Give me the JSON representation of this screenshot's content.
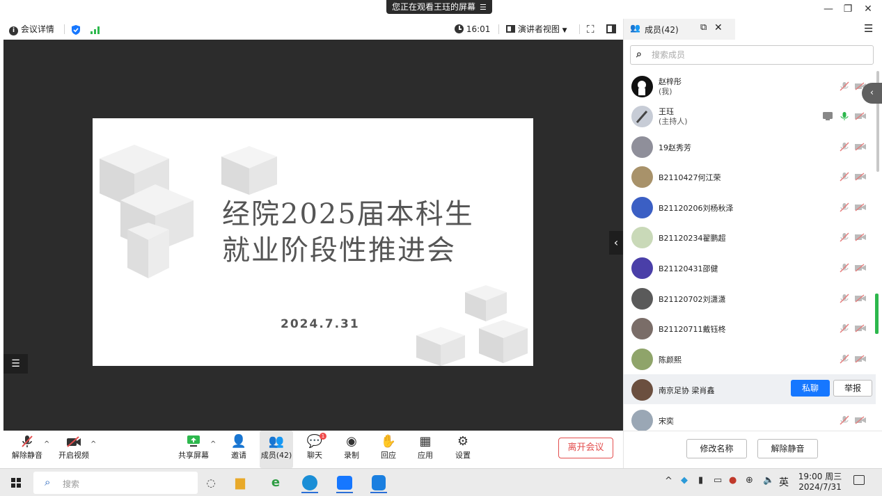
{
  "titlebar": {
    "share_notice": "您正在观看王珏的屏幕",
    "share_menu_glyph": "☰"
  },
  "meeting_bar": {
    "details_label": "会议详情",
    "time": "16:01",
    "view_mode": "演讲者视图"
  },
  "slide": {
    "title_line1": "经院2025届本科生",
    "title_line2": "就业阶段性推进会",
    "date": "2024.7.31"
  },
  "controls": {
    "unmute": "解除静音",
    "start_video": "开启视频",
    "share_screen": "共享屏幕",
    "invite": "邀请",
    "members": "成员(42)",
    "chat": "聊天",
    "chat_badge": "1",
    "record": "录制",
    "react": "回应",
    "apps": "应用",
    "settings": "设置",
    "leave": "离开会议"
  },
  "panel": {
    "tab_label": "成员(42)",
    "search_placeholder": "搜索成员",
    "members": [
      {
        "name": "赵梓彤",
        "role": "(我)"
      },
      {
        "name": "王珏",
        "role": "(主持人)"
      },
      {
        "name": "19赵秀芳",
        "role": ""
      },
      {
        "name": "B2110427何江荣",
        "role": ""
      },
      {
        "name": "B21120206刘杨秋泽",
        "role": ""
      },
      {
        "name": "B21120234翟鹏超",
        "role": ""
      },
      {
        "name": "B21120431邵健",
        "role": ""
      },
      {
        "name": "B21120702刘潇潇",
        "role": ""
      },
      {
        "name": "B21120711戴钰柊",
        "role": ""
      },
      {
        "name": "陈颜熙",
        "role": ""
      },
      {
        "name": "南京足协 梁肖鑫",
        "role": ""
      },
      {
        "name": "宋奕",
        "role": ""
      }
    ],
    "private_chat": "私聊",
    "report": "举报",
    "rename": "修改名称",
    "unmute_all": "解除静音"
  },
  "taskbar": {
    "search_placeholder": "搜索",
    "ime": "英",
    "clock_time": "19:00 周三",
    "clock_date": "2024/7/31"
  },
  "colors": {
    "accent": "#1677ff",
    "leave": "#e34d4d",
    "mic_active": "#2db84d",
    "muted": "#e57a7a"
  }
}
